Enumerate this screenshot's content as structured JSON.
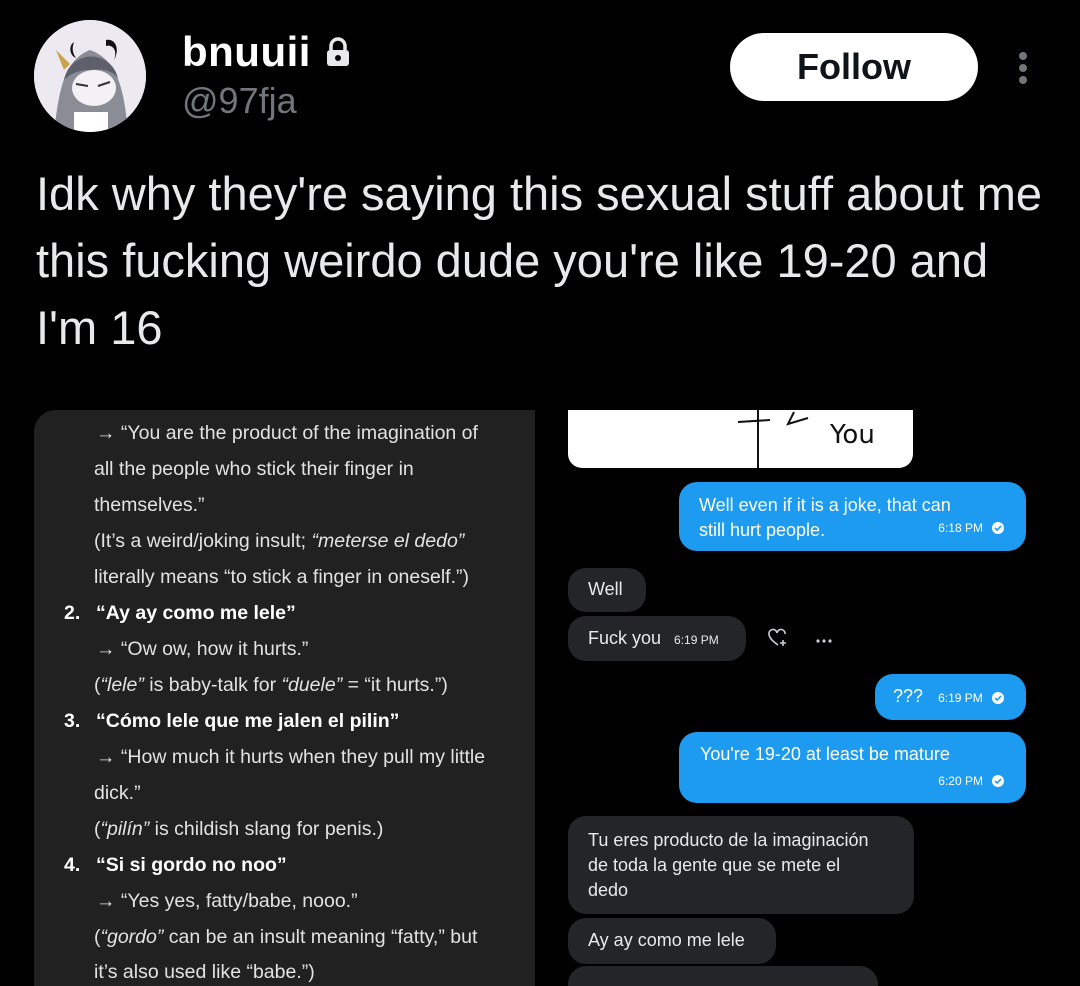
{
  "header": {
    "display_name": "bnuuii",
    "handle": "@97fja",
    "follow_label": "Follow"
  },
  "tweet": {
    "text": "Idk why they're saying this sexual stuff about me this fucking weirdo dude you're like 19-20 and I'm 16"
  },
  "translation": {
    "lines": [
      "→ “You are the product of the imagination of",
      "all the people who stick their finger in",
      "themselves.”",
      "(It’s a weird/joking insult; ",
      "“meterse el dedo”",
      "literally means “to stick a finger in oneself.”)",
      "→ “Ow ow, how it hurts.”",
      "(",
      "“lele”",
      " is baby-talk for ",
      "“duele”",
      " = “it hurts.”)",
      "→ “How much it hurts when they pull my little",
      "dick.”",
      "(",
      "“pilín”",
      " is childish slang for penis.)",
      "→ “Yes yes, fatty/babe, nooo.”",
      "(",
      "“gordo”",
      " can be an insult meaning “fatty,” but",
      "it’s also used like “babe.”)"
    ],
    "items": [
      {
        "number": "2.",
        "heading": "“Ay ay como me lele”"
      },
      {
        "number": "3.",
        "heading": "“Cómo lele que me jalen el pilin”"
      },
      {
        "number": "4.",
        "heading": "“Si si gordo no noo”"
      }
    ]
  },
  "chat": {
    "sketch_label": "You",
    "messages": [
      {
        "dir": "out",
        "lines": [
          "Well even if it is a joke, that can",
          "still hurt people."
        ],
        "time": "6:18 PM"
      },
      {
        "dir": "in",
        "text": "Well"
      },
      {
        "dir": "in",
        "text": "Fuck you",
        "time": "6:19 PM"
      },
      {
        "dir": "out",
        "text": "???",
        "time": "6:19 PM"
      },
      {
        "dir": "out",
        "text": "You're 19-20 at least be mature",
        "time": "6:20 PM"
      },
      {
        "dir": "in",
        "lines": [
          "Tu eres producto de la imaginación",
          "de toda la gente que se mete el",
          "dedo"
        ]
      },
      {
        "dir": "in",
        "text": "Ay ay como me lele"
      }
    ]
  },
  "colors": {
    "background": "#000000",
    "accent": "#1d9bf0",
    "incoming_bubble": "#232528",
    "panel": "#212121"
  },
  "icons": [
    "lock-icon",
    "more-vertical-icon",
    "add-reaction-icon",
    "more-horizontal-icon",
    "read-check-icon"
  ]
}
